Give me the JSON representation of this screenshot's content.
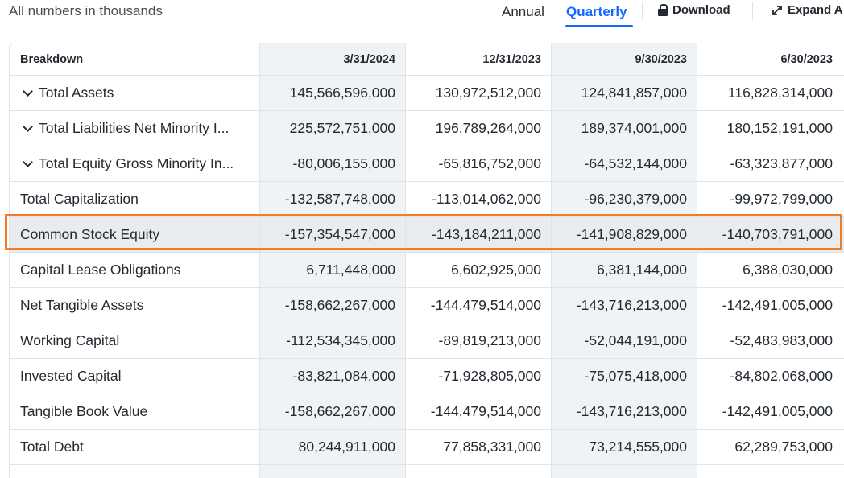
{
  "units_note": "All numbers in thousands",
  "toolbar": {
    "annual_label": "Annual",
    "quarterly_label": "Quarterly",
    "download_label": "Download",
    "expand_label": "Expand A"
  },
  "table": {
    "header": {
      "breakdown": "Breakdown",
      "dates": [
        "3/31/2024",
        "12/31/2023",
        "9/30/2023",
        "6/30/2023"
      ]
    },
    "rows": [
      {
        "label": "Total Assets",
        "expandable": true,
        "values": [
          "145,566,596,000",
          "130,972,512,000",
          "124,841,857,000",
          "116,828,314,000"
        ]
      },
      {
        "label": "Total Liabilities Net Minority I...",
        "expandable": true,
        "values": [
          "225,572,751,000",
          "196,789,264,000",
          "189,374,001,000",
          "180,152,191,000"
        ]
      },
      {
        "label": "Total Equity Gross Minority In...",
        "expandable": true,
        "values": [
          "-80,006,155,000",
          "-65,816,752,000",
          "-64,532,144,000",
          "-63,323,877,000"
        ]
      },
      {
        "label": "Total Capitalization",
        "expandable": false,
        "values": [
          "-132,587,748,000",
          "-113,014,062,000",
          "-96,230,379,000",
          "-99,972,799,000"
        ]
      },
      {
        "label": "Common Stock Equity",
        "expandable": false,
        "highlighted": true,
        "values": [
          "-157,354,547,000",
          "-143,184,211,000",
          "-141,908,829,000",
          "-140,703,791,000"
        ]
      },
      {
        "label": "Capital Lease Obligations",
        "expandable": false,
        "values": [
          "6,711,448,000",
          "6,602,925,000",
          "6,381,144,000",
          "6,388,030,000"
        ]
      },
      {
        "label": "Net Tangible Assets",
        "expandable": false,
        "values": [
          "-158,662,267,000",
          "-144,479,514,000",
          "-143,716,213,000",
          "-142,491,005,000"
        ]
      },
      {
        "label": "Working Capital",
        "expandable": false,
        "values": [
          "-112,534,345,000",
          "-89,819,213,000",
          "-52,044,191,000",
          "-52,483,983,000"
        ]
      },
      {
        "label": "Invested Capital",
        "expandable": false,
        "values": [
          "-83,821,084,000",
          "-71,928,805,000",
          "-75,075,418,000",
          "-84,802,068,000"
        ]
      },
      {
        "label": "Tangible Book Value",
        "expandable": false,
        "values": [
          "-158,662,267,000",
          "-144,479,514,000",
          "-143,716,213,000",
          "-142,491,005,000"
        ]
      },
      {
        "label": "Total Debt",
        "expandable": false,
        "values": [
          "80,244,911,000",
          "77,858,331,000",
          "73,214,555,000",
          "62,289,753,000"
        ]
      }
    ]
  },
  "colors": {
    "accent": "#0f69ff",
    "highlight_border": "#f57c22",
    "column_shade": "#f0f3f5"
  }
}
